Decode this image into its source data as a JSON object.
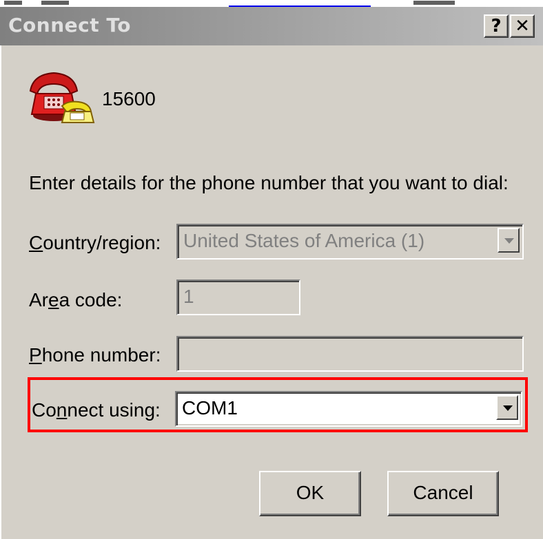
{
  "window": {
    "title": "Connect To",
    "help_button": "?",
    "close_button": "✕"
  },
  "connection": {
    "name": "15600",
    "icon": "phone-icon"
  },
  "form": {
    "prompt": "Enter details for the phone number that you want to dial:",
    "country_label_accel": "C",
    "country_label_rest": "ountry/region:",
    "country_value": "United States of America (1)",
    "area_label_pre": "Ar",
    "area_label_accel": "e",
    "area_label_post": "a code:",
    "area_value": "1",
    "phone_label_accel": "P",
    "phone_label_rest": "hone number:",
    "phone_value": "",
    "connect_label_pre": "Co",
    "connect_label_accel": "n",
    "connect_label_post": "nect using:",
    "connect_value": "COM1"
  },
  "buttons": {
    "ok": "OK",
    "cancel": "Cancel"
  },
  "colors": {
    "highlight": "#ff0000",
    "dialog_bg": "#d4d0c8",
    "titlebar_start": "#808080",
    "titlebar_end": "#c0c0c0"
  }
}
